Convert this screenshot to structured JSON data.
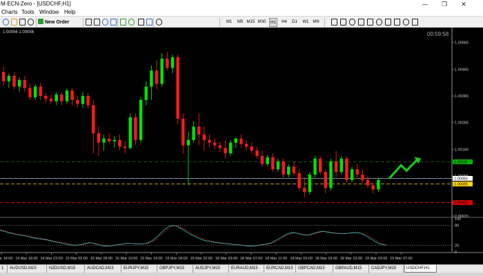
{
  "window": {
    "title": "M-ECN-Zero - [USDCHF,H1]",
    "minimize": "—",
    "restore": "❐",
    "close": "✕"
  },
  "menu": [
    "Charts",
    "Tools",
    "Window",
    "Help"
  ],
  "toolbar": {
    "new_order": "New Order",
    "timeframes": [
      "M1",
      "M5",
      "M15",
      "M30",
      "H1",
      "H4",
      "D1",
      "W1",
      "MN"
    ],
    "active_timeframe": "H1",
    "icons": [
      "new-chart-icon",
      "profiles-icon",
      "bar-chart-icon",
      "candlestick-icon",
      "line-chart-icon",
      "zoom-in-icon",
      "zoom-out-icon",
      "tile-icon",
      "autoscroll-icon",
      "chart-shift-icon",
      "indicators-icon",
      "periods-icon",
      "templates-icon",
      "cursor-icon",
      "crosshair-icon",
      "vertical-line-icon",
      "horizontal-line-icon",
      "trendline-icon",
      "channel-icon",
      "fibonacci-icon",
      "text-icon",
      "label-icon",
      "arrows-icon"
    ]
  },
  "chart": {
    "info": "1.00056 1.00056",
    "countdown": "00:59:58",
    "colors": {
      "bull": "#00e600",
      "bear": "#ff1a1a",
      "background": "#000000"
    }
  },
  "chart_data": {
    "type": "candlestick",
    "symbol": "USDCHF",
    "timeframe": "H1",
    "y_ticks": [
      "1.00565",
      "1.00465",
      "1.00365",
      "1.00265",
      "1.00165",
      "1.00065",
      "0.99965",
      "0.99915"
    ],
    "ylim": [
      0.99915,
      1.00585
    ],
    "x_ticks": [
      "14 Mar 14:00",
      "14 Mar 18:00",
      "14 Mar 22:00",
      "15 Mar 02:00",
      "15 Mar 06:00",
      "15 Mar 10:00",
      "15 Mar 14:00",
      "15 Mar 18:00",
      "15 Mar 22:00",
      "18 Mar 03:00",
      "18 Mar 07:00",
      "18 Mar 11:00",
      "18 Mar 15:00",
      "18 Mar 19:00",
      "18 Mar 23:00",
      "19 Mar 03:00",
      "19 Mar 07:00"
    ],
    "candles": [
      {
        "o": 1.00455,
        "h": 1.00475,
        "l": 1.00405,
        "c": 1.0042
      },
      {
        "o": 1.0042,
        "h": 1.0045,
        "l": 1.00395,
        "c": 1.0044
      },
      {
        "o": 1.0044,
        "h": 1.00455,
        "l": 1.0039,
        "c": 1.004
      },
      {
        "o": 1.004,
        "h": 1.00435,
        "l": 1.0038,
        "c": 1.00425
      },
      {
        "o": 1.00425,
        "h": 1.0044,
        "l": 1.0038,
        "c": 1.00395
      },
      {
        "o": 1.00395,
        "h": 1.0041,
        "l": 1.0035,
        "c": 1.0036
      },
      {
        "o": 1.0036,
        "h": 1.0041,
        "l": 1.0035,
        "c": 1.004
      },
      {
        "o": 1.004,
        "h": 1.00415,
        "l": 1.0035,
        "c": 1.00365
      },
      {
        "o": 1.00365,
        "h": 1.00375,
        "l": 1.0034,
        "c": 1.00355
      },
      {
        "o": 1.00355,
        "h": 1.0037,
        "l": 1.00335,
        "c": 1.00345
      },
      {
        "o": 1.00345,
        "h": 1.0038,
        "l": 1.0033,
        "c": 1.0037
      },
      {
        "o": 1.0037,
        "h": 1.0038,
        "l": 1.0033,
        "c": 1.00345
      },
      {
        "o": 1.00345,
        "h": 1.00395,
        "l": 1.00335,
        "c": 1.00385
      },
      {
        "o": 1.00385,
        "h": 1.00395,
        "l": 1.0033,
        "c": 1.0035
      },
      {
        "o": 1.0035,
        "h": 1.00365,
        "l": 1.0032,
        "c": 1.00335
      },
      {
        "o": 1.00335,
        "h": 1.0038,
        "l": 1.0032,
        "c": 1.00365
      },
      {
        "o": 1.00365,
        "h": 1.00375,
        "l": 1.0032,
        "c": 1.0033
      },
      {
        "o": 1.0033,
        "h": 1.0035,
        "l": 1.0015,
        "c": 1.00225
      },
      {
        "o": 1.00225,
        "h": 1.0025,
        "l": 1.0014,
        "c": 1.0019
      },
      {
        "o": 1.0019,
        "h": 1.0022,
        "l": 1.0016,
        "c": 1.00205
      },
      {
        "o": 1.00205,
        "h": 1.00225,
        "l": 1.00185,
        "c": 1.00195
      },
      {
        "o": 1.00195,
        "h": 1.00215,
        "l": 1.0017,
        "c": 1.002
      },
      {
        "o": 1.002,
        "h": 1.0022,
        "l": 1.0016,
        "c": 1.00175
      },
      {
        "o": 1.00175,
        "h": 1.00195,
        "l": 1.0015,
        "c": 1.0017
      },
      {
        "o": 1.0017,
        "h": 1.003,
        "l": 1.00165,
        "c": 1.00285
      },
      {
        "o": 1.00285,
        "h": 1.003,
        "l": 1.0018,
        "c": 1.002
      },
      {
        "o": 1.002,
        "h": 1.0036,
        "l": 1.0019,
        "c": 1.0035
      },
      {
        "o": 1.0035,
        "h": 1.0042,
        "l": 1.0033,
        "c": 1.004
      },
      {
        "o": 1.004,
        "h": 1.0048,
        "l": 1.0035,
        "c": 1.0046
      },
      {
        "o": 1.0046,
        "h": 1.005,
        "l": 1.0039,
        "c": 1.0041
      },
      {
        "o": 1.0041,
        "h": 1.00525,
        "l": 1.004,
        "c": 1.00505
      },
      {
        "o": 1.00505,
        "h": 1.0053,
        "l": 1.0046,
        "c": 1.0047
      },
      {
        "o": 1.0047,
        "h": 1.0052,
        "l": 1.0045,
        "c": 1.0051
      },
      {
        "o": 1.0051,
        "h": 1.0052,
        "l": 1.0026,
        "c": 1.0028
      },
      {
        "o": 1.0028,
        "h": 1.003,
        "l": 1.0015,
        "c": 1.0018
      },
      {
        "o": 1.0018,
        "h": 1.0023,
        "l": 1.0003,
        "c": 1.002
      },
      {
        "o": 1.002,
        "h": 1.0027,
        "l": 1.0019,
        "c": 1.0025
      },
      {
        "o": 1.0025,
        "h": 1.003,
        "l": 1.0018,
        "c": 1.0022
      },
      {
        "o": 1.0022,
        "h": 1.0025,
        "l": 1.0016,
        "c": 1.002
      },
      {
        "o": 1.002,
        "h": 1.0022,
        "l": 1.0017,
        "c": 1.0019
      },
      {
        "o": 1.0019,
        "h": 1.00205,
        "l": 1.00165,
        "c": 1.0018
      },
      {
        "o": 1.0018,
        "h": 1.00195,
        "l": 1.00155,
        "c": 1.0017
      },
      {
        "o": 1.0017,
        "h": 1.002,
        "l": 1.0013,
        "c": 1.0015
      },
      {
        "o": 1.0015,
        "h": 1.002,
        "l": 1.0014,
        "c": 1.0019
      },
      {
        "o": 1.0019,
        "h": 1.0021,
        "l": 1.0017,
        "c": 1.00205
      },
      {
        "o": 1.00205,
        "h": 1.0022,
        "l": 1.0017,
        "c": 1.00185
      },
      {
        "o": 1.00185,
        "h": 1.002,
        "l": 1.0016,
        "c": 1.00175
      },
      {
        "o": 1.00175,
        "h": 1.0019,
        "l": 1.0015,
        "c": 1.0016
      },
      {
        "o": 1.0016,
        "h": 1.00175,
        "l": 1.0013,
        "c": 1.0014
      },
      {
        "o": 1.0014,
        "h": 1.0016,
        "l": 1.001,
        "c": 1.0011
      },
      {
        "o": 1.0011,
        "h": 1.00145,
        "l": 1.001,
        "c": 1.00135
      },
      {
        "o": 1.00135,
        "h": 1.0015,
        "l": 1.0008,
        "c": 1.0009
      },
      {
        "o": 1.0009,
        "h": 1.0013,
        "l": 1.0008,
        "c": 1.0012
      },
      {
        "o": 1.0012,
        "h": 1.0013,
        "l": 1.0006,
        "c": 1.0007
      },
      {
        "o": 1.0007,
        "h": 1.0011,
        "l": 1.0006,
        "c": 1.001
      },
      {
        "o": 1.001,
        "h": 1.0012,
        "l": 1.00065,
        "c": 1.00075
      },
      {
        "o": 1.00075,
        "h": 1.0009,
        "l": 1.0001,
        "c": 1.0002
      },
      {
        "o": 1.0002,
        "h": 1.0006,
        "l": 0.99985,
        "c": 1.00005
      },
      {
        "o": 1.00005,
        "h": 1.0008,
        "l": 0.99995,
        "c": 1.0007
      },
      {
        "o": 1.0007,
        "h": 1.0014,
        "l": 1.0006,
        "c": 1.0013
      },
      {
        "o": 1.0013,
        "h": 1.0014,
        "l": 1.0007,
        "c": 1.0008
      },
      {
        "o": 1.0008,
        "h": 1.0009,
        "l": 1.0,
        "c": 1.0002
      },
      {
        "o": 1.0002,
        "h": 1.0013,
        "l": 1.0001,
        "c": 1.0012
      },
      {
        "o": 1.0012,
        "h": 1.0016,
        "l": 1.0006,
        "c": 1.0008
      },
      {
        "o": 1.0008,
        "h": 1.0014,
        "l": 1.0007,
        "c": 1.0013
      },
      {
        "o": 1.0013,
        "h": 1.0014,
        "l": 1.0004,
        "c": 1.0005
      },
      {
        "o": 1.0005,
        "h": 1.001,
        "l": 1.0004,
        "c": 1.0009
      },
      {
        "o": 1.0009,
        "h": 1.0011,
        "l": 1.0006,
        "c": 1.0007
      },
      {
        "o": 1.0007,
        "h": 1.0009,
        "l": 1.0004,
        "c": 1.0005
      },
      {
        "o": 1.0005,
        "h": 1.00065,
        "l": 1.0002,
        "c": 1.0003
      },
      {
        "o": 1.0003,
        "h": 1.0004,
        "l": 1.0,
        "c": 1.00015
      },
      {
        "o": 1.00015,
        "h": 1.0006,
        "l": 1.00005,
        "c": 1.0005
      }
    ],
    "levels": [
      {
        "value": 1.00118,
        "label": "1.00118",
        "color": "#0b5a0b",
        "label_bg": "#00b400",
        "style": "dashed"
      },
      {
        "value": 1.00056,
        "label": "1.00056",
        "color": "#7f8a9c",
        "label_bg": "#ffffff",
        "style": "solid"
      },
      {
        "value": 1.00035,
        "label": "1.00035",
        "color": "#c7a21a",
        "label_bg": "#ffd400",
        "style": "dashed"
      },
      {
        "value": 0.99965,
        "label": "0.99965",
        "color": "#d81010",
        "label_bg": "#e00000",
        "style": "dashed"
      }
    ],
    "oscillator": {
      "ylim": [
        0,
        100
      ],
      "levels": [
        80,
        20
      ],
      "y_ticks": [
        "100",
        "80",
        "20",
        "0"
      ],
      "main": [
        65,
        62,
        58,
        55,
        52,
        50,
        48,
        45,
        42,
        40,
        38,
        36,
        33,
        30,
        28,
        25,
        22,
        20,
        20,
        22,
        25,
        28,
        26,
        22,
        18,
        17,
        18,
        20,
        22,
        24,
        26,
        25,
        24,
        24,
        25,
        28,
        35,
        45,
        58,
        70,
        78,
        80,
        75,
        68,
        60,
        52,
        46,
        40,
        35,
        32,
        30,
        28,
        26,
        25,
        24,
        22,
        21,
        20,
        18,
        17,
        18,
        20,
        22,
        24,
        28,
        35,
        42,
        50,
        56,
        58,
        56,
        52,
        50,
        52,
        56,
        60,
        62,
        60,
        58,
        56,
        55,
        55,
        56,
        58,
        58,
        56,
        50,
        42,
        34,
        26,
        22,
        20
      ],
      "signal": [
        67,
        64,
        60,
        57,
        54,
        52,
        50,
        47,
        44,
        42,
        40,
        38,
        35,
        32,
        30,
        28,
        25,
        22,
        21,
        21,
        23,
        26,
        27,
        25,
        21,
        19,
        18,
        19,
        21,
        23,
        25,
        25,
        25,
        24,
        24,
        26,
        31,
        40,
        51,
        63,
        73,
        79,
        78,
        72,
        65,
        57,
        50,
        44,
        39,
        35,
        32,
        30,
        28,
        26,
        25,
        23,
        22,
        21,
        20,
        18,
        18,
        19,
        21,
        23,
        26,
        31,
        38,
        46,
        53,
        57,
        57,
        54,
        52,
        51,
        54,
        58,
        61,
        61,
        59,
        57,
        56,
        55,
        56,
        57,
        58,
        57,
        54,
        47,
        39,
        31,
        25,
        21
      ]
    }
  },
  "tabs": [
    "1",
    "AUDUSD,M15",
    "NZDUSD,M15",
    "AUDCAD,M15",
    "EURJPY,M15",
    "GBPJPY,M15",
    "AUDJPY,M15",
    "EURAUD,M15",
    "EURCAD,M15",
    "GBPCAD,M15",
    "GBPAUD,M15",
    "CADJPY,M15",
    "USDCHF,H1"
  ],
  "active_tab": "USDCHF,H1"
}
